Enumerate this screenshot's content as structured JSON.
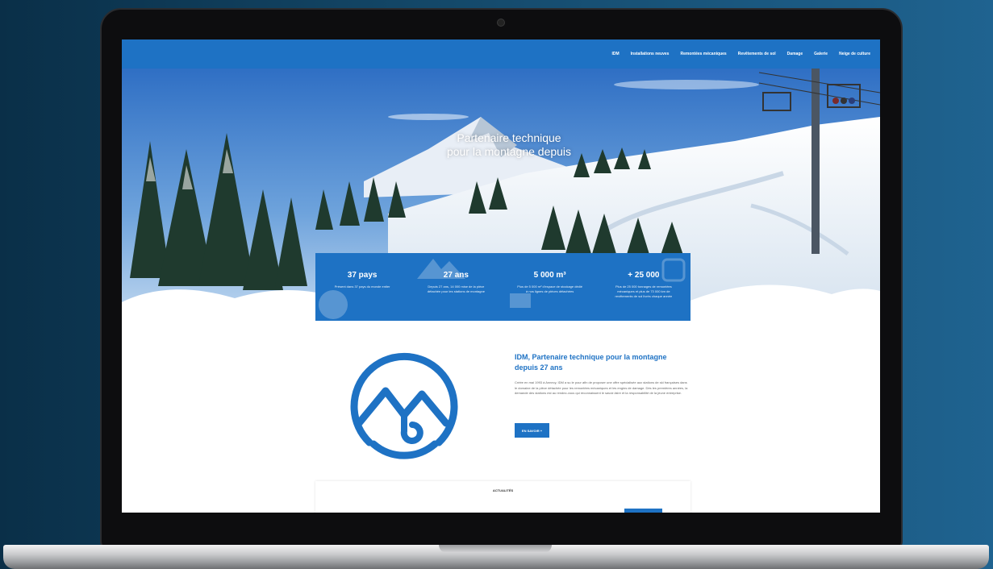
{
  "nav": {
    "items": [
      "IDM",
      "Installations neuves",
      "Remontées mécaniques",
      "Revêtements de sol",
      "Damage",
      "Galerie",
      "Neige de culture"
    ]
  },
  "hero": {
    "title_line1": "Partenaire technique",
    "title_line2": "pour la montagne depuis"
  },
  "stats": [
    {
      "value": "37 pays",
      "desc": "Présent dans 37 pays du monde entier"
    },
    {
      "value": "27 ans",
      "desc": "Depuis 27 ans, 14 000 mise de la pièce détachée pour les stations de montagne"
    },
    {
      "value": "5 000 m³",
      "desc": "Plus de 5 000 m² d'espace de stockage dédié à nos lignes de pièces détachées"
    },
    {
      "value": "+ 25 000",
      "desc": "Plus de 25 000 tonnages de remontées mécaniques et plus de 73 000 km de revêtements de sol livrés chaque année"
    }
  ],
  "about": {
    "title": "IDM, Partenaire technique pour la montagne depuis 27 ans",
    "text": "Créée en mai 1993 à Annecy, IDM a su le pour afin de proposer une offre spécialisée aux stations de ski françaises dans le domaine de la pièce détachée pour les remontées mécaniques et les engins de damage. Dès les premières années, la demande des stations est au rendez-vous qui reconnaissent le savoir-faire et la responsabilité de la jeune entreprise.",
    "button_label": "EN SAVOIR +"
  },
  "news": {
    "title": "ACTUALITÉS"
  },
  "colors": {
    "brand": "#1e72c4",
    "background": "#14496a"
  }
}
